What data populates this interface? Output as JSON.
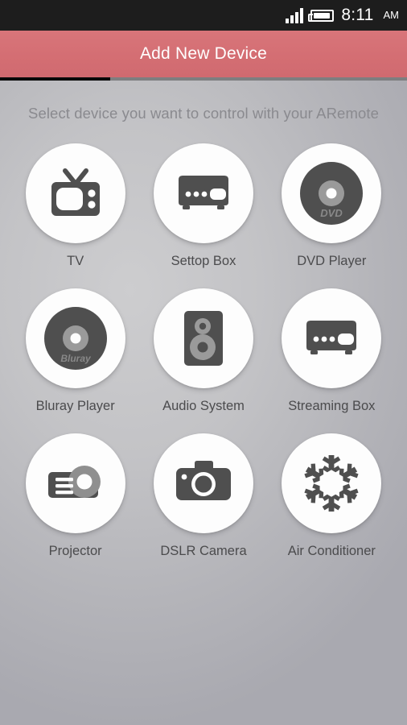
{
  "status_bar": {
    "signal_icon": "signal-bars-icon",
    "signal_bars": 4,
    "battery_icon": "battery-icon",
    "battery_level": 70,
    "time": "8:11",
    "meridiem": "AM"
  },
  "header": {
    "title": "Add New Device",
    "accent_color": "#d46e73"
  },
  "progress_indicator": {
    "filled_percent": 27,
    "filled_color": "#090909",
    "track_color": "#7e7e80"
  },
  "content": {
    "subtitle": "Select device you want to control with your ARemote",
    "icon_color": "#4f4f4f",
    "circle_color": "#fdfdfd",
    "label_color": "#4b4b4d",
    "devices": [
      {
        "label": "TV",
        "icon": "retro-tv-icon"
      },
      {
        "label": "Settop Box",
        "icon": "settop-box-icon"
      },
      {
        "label": "DVD Player",
        "icon": "dvd-disc-icon",
        "disc_text": "DVD"
      },
      {
        "label": "Bluray Player",
        "icon": "bluray-disc-icon",
        "disc_text": "Bluray"
      },
      {
        "label": "Audio System",
        "icon": "speaker-icon"
      },
      {
        "label": "Streaming Box",
        "icon": "streaming-box-icon"
      },
      {
        "label": "Projector",
        "icon": "projector-icon"
      },
      {
        "label": "DSLR Camera",
        "icon": "dslr-camera-icon"
      },
      {
        "label": "Air Conditioner",
        "icon": "snowflake-icon"
      }
    ]
  }
}
